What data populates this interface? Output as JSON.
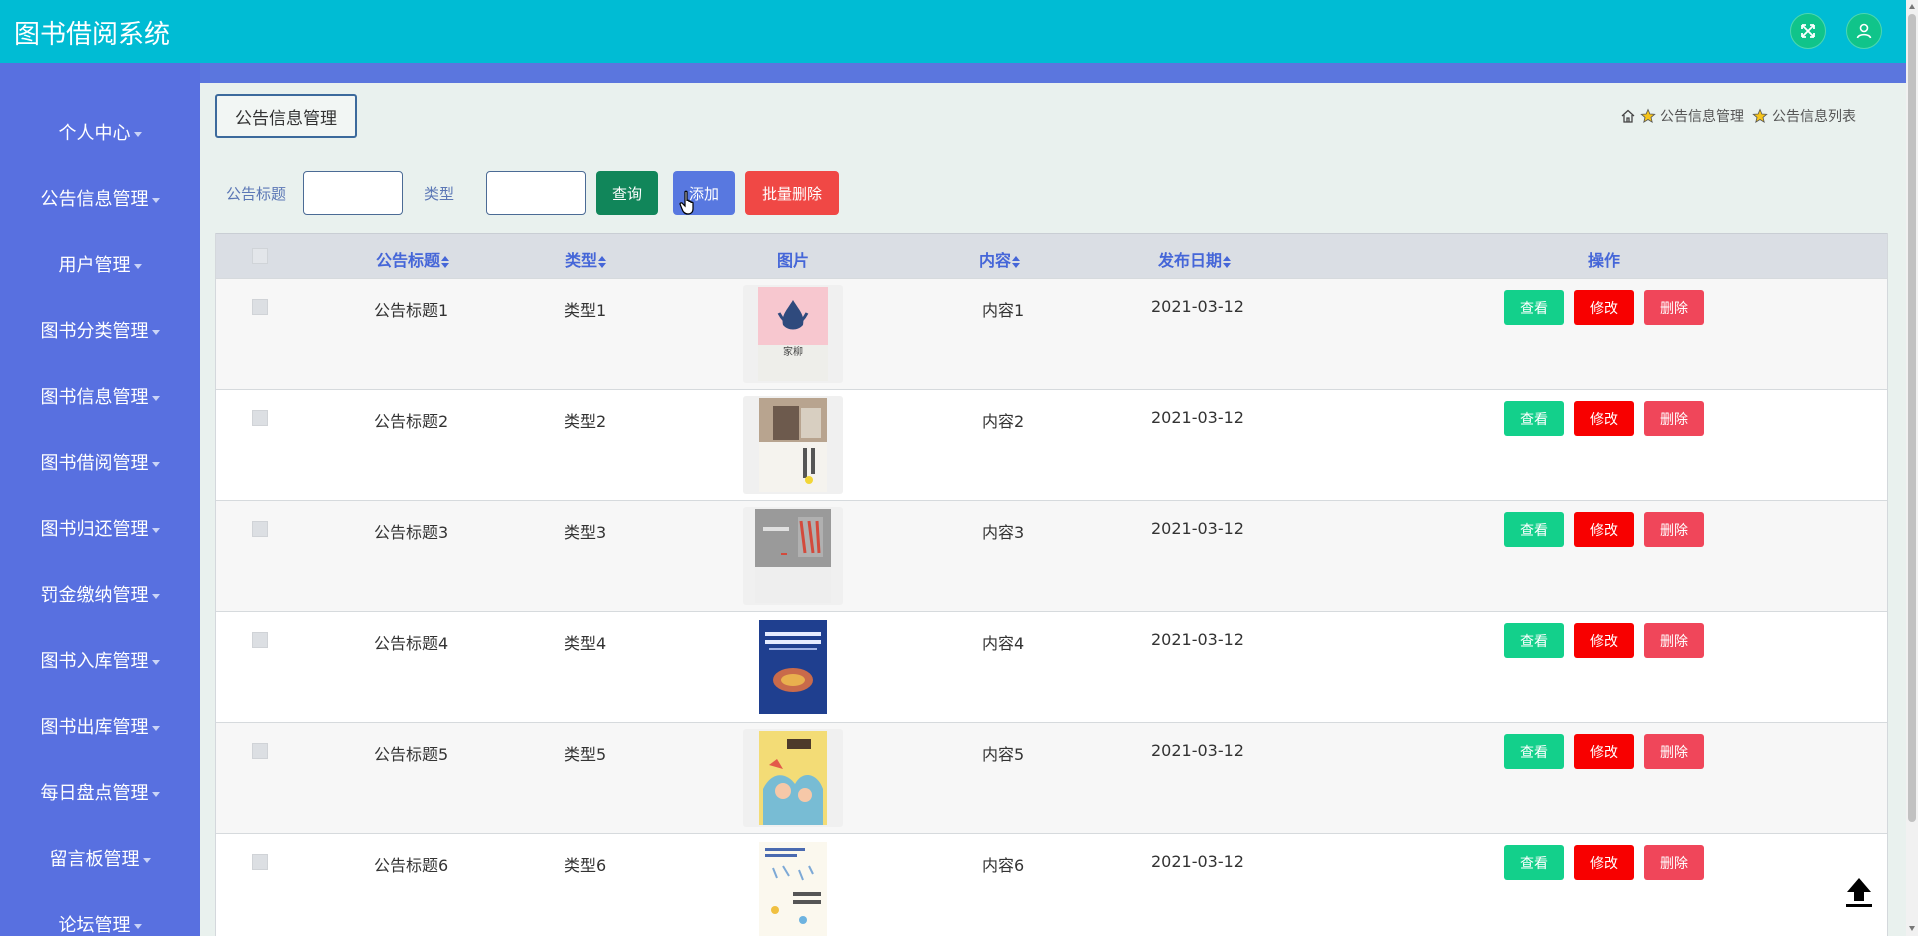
{
  "app": {
    "title": "图书借阅系统"
  },
  "header": {
    "icons": [
      "expand-icon",
      "user-icon"
    ],
    "accent": "#00bcd4"
  },
  "sidebar": {
    "bg": "#5870e0",
    "items": [
      {
        "label": "个人中心"
      },
      {
        "label": "公告信息管理"
      },
      {
        "label": "用户管理"
      },
      {
        "label": "图书分类管理"
      },
      {
        "label": "图书信息管理"
      },
      {
        "label": "图书借阅管理"
      },
      {
        "label": "图书归还管理"
      },
      {
        "label": "罚金缴纳管理"
      },
      {
        "label": "图书入库管理"
      },
      {
        "label": "图书出库管理"
      },
      {
        "label": "每日盘点管理"
      },
      {
        "label": "留言板管理"
      },
      {
        "label": "论坛管理"
      }
    ]
  },
  "page": {
    "tag": "公告信息管理",
    "breadcrumb": [
      "公告信息管理",
      "公告信息列表"
    ]
  },
  "search": {
    "title_label": "公告标题",
    "title_value": "",
    "type_label": "类型",
    "type_value": "",
    "query_label": "查询",
    "add_label": "添加",
    "batch_delete_label": "批量删除"
  },
  "table": {
    "headers": {
      "title": "公告标题",
      "type": "类型",
      "image": "图片",
      "content": "内容",
      "date": "发布日期",
      "actions": "操作"
    },
    "action_labels": {
      "view": "查看",
      "edit": "修改",
      "delete": "删除"
    },
    "rows": [
      {
        "title": "公告标题1",
        "type": "类型1",
        "content": "内容1",
        "date": "2021-03-12"
      },
      {
        "title": "公告标题2",
        "type": "类型2",
        "content": "内容2",
        "date": "2021-03-12"
      },
      {
        "title": "公告标题3",
        "type": "类型3",
        "content": "内容3",
        "date": "2021-03-12"
      },
      {
        "title": "公告标题4",
        "type": "类型4",
        "content": "内容4",
        "date": "2021-03-12"
      },
      {
        "title": "公告标题5",
        "type": "类型5",
        "content": "内容5",
        "date": "2021-03-12"
      },
      {
        "title": "公告标题6",
        "type": "类型6",
        "content": "内容6",
        "date": "2021-03-12"
      }
    ]
  }
}
